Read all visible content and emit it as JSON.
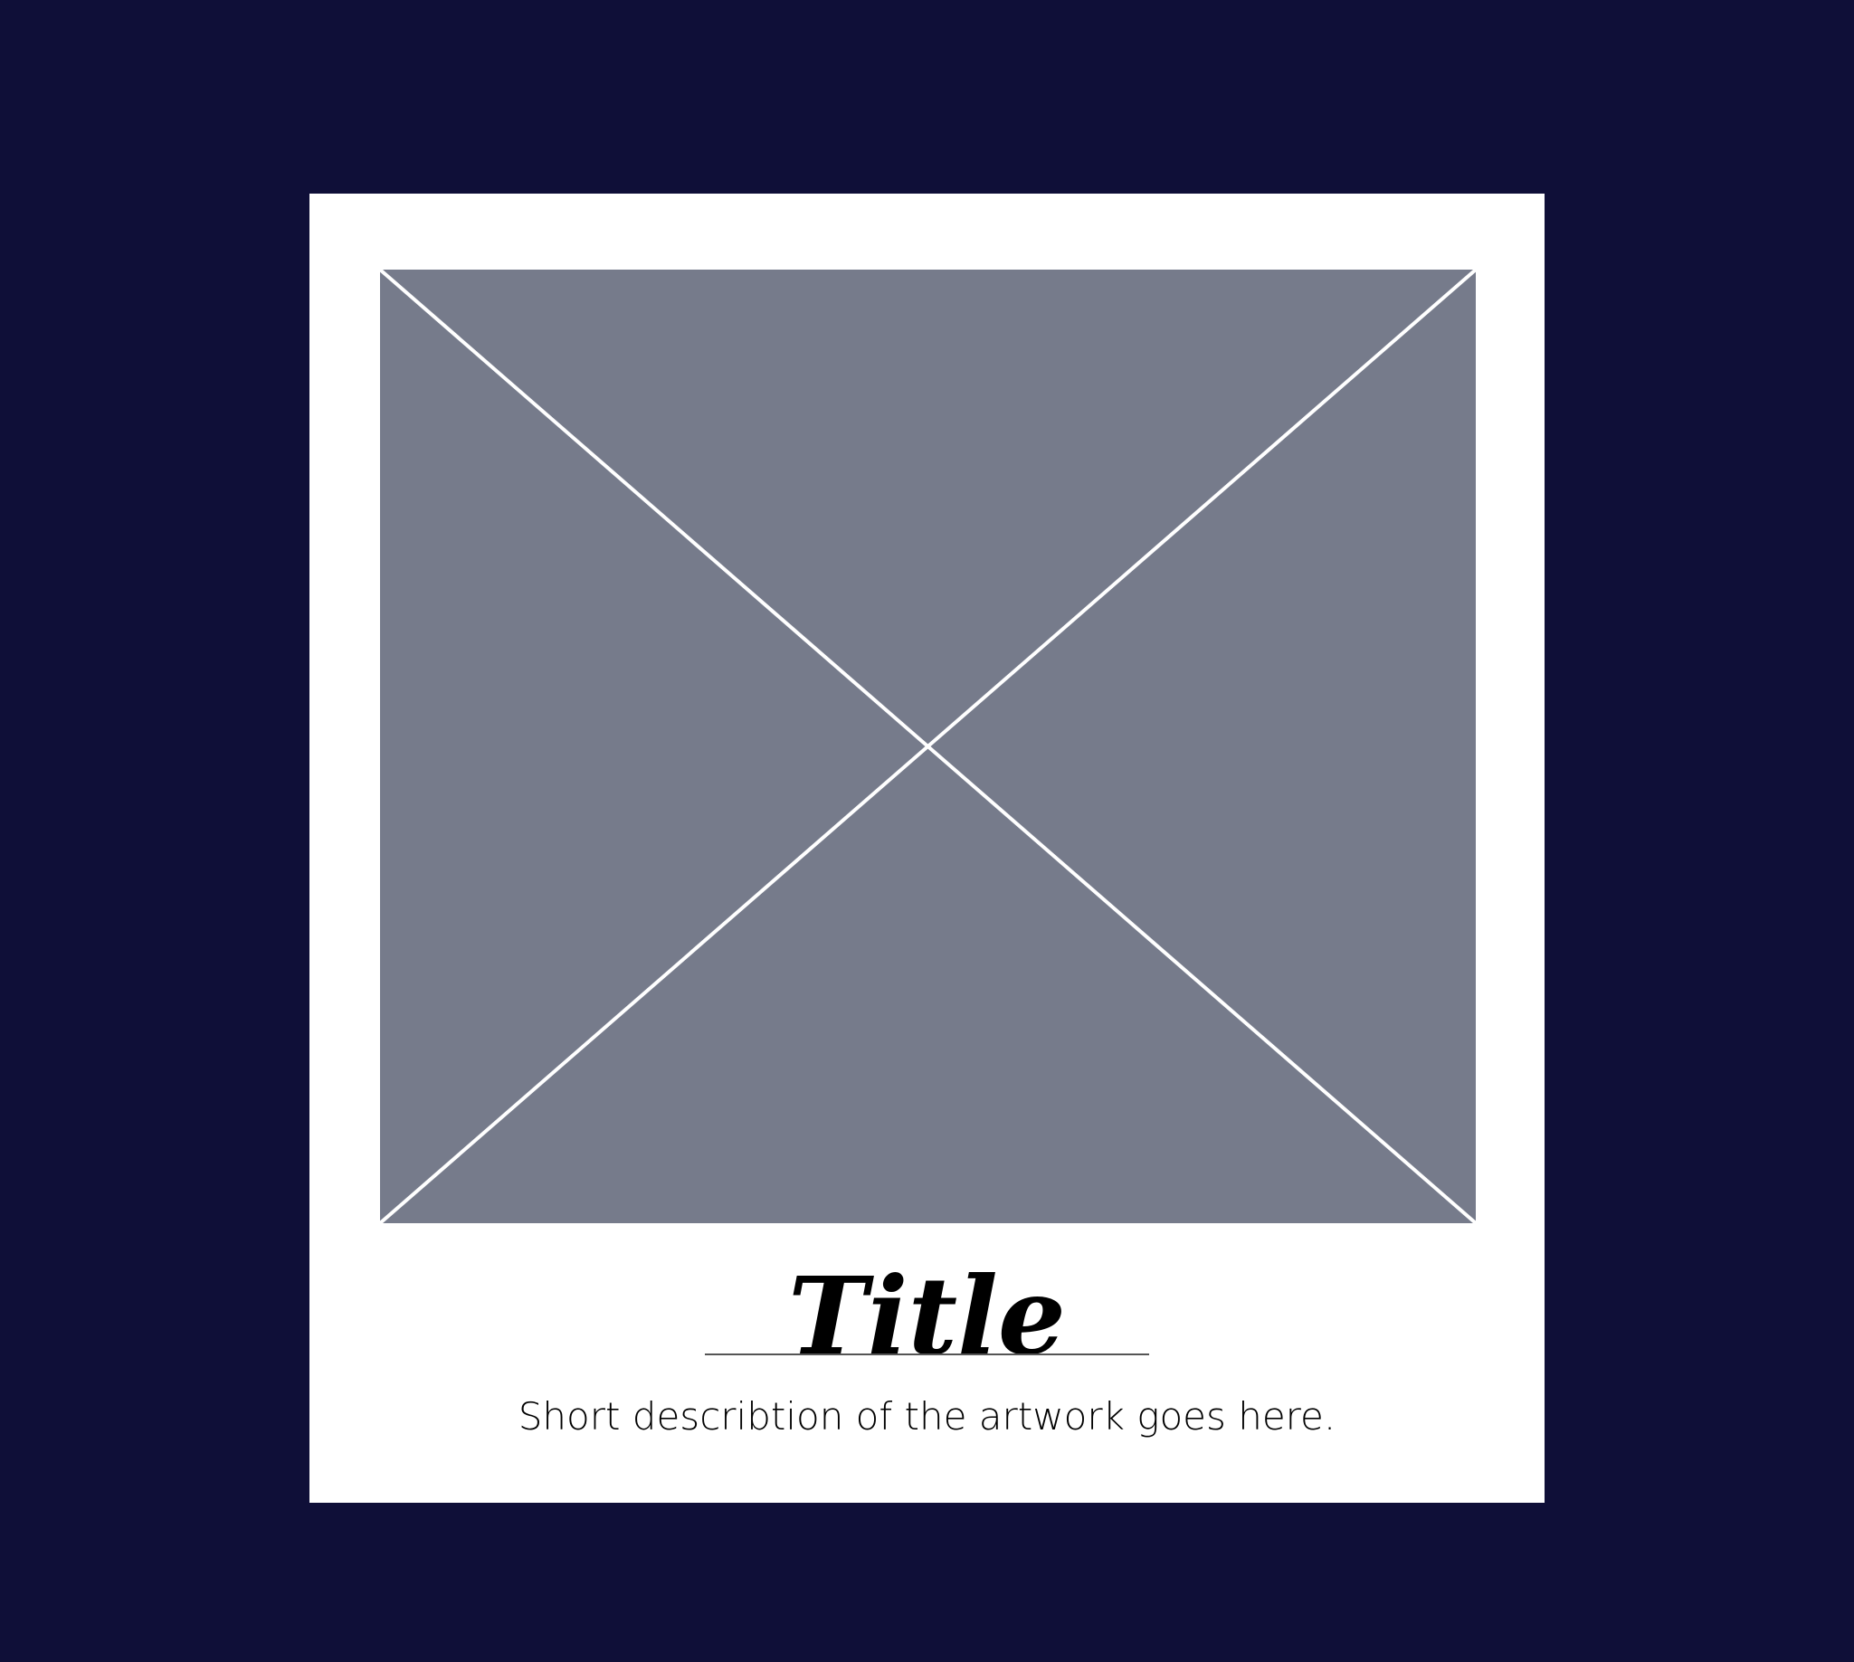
{
  "colors": {
    "background": "#0f0f38",
    "card": "#ffffff",
    "placeholder_fill": "#767b8b",
    "placeholder_lines": "#ffffff",
    "text": "#000000",
    "rule": "#555555"
  },
  "card": {
    "title": "Title",
    "description": "Short describtion of the artwork goes here.",
    "image_icon": "image-placeholder-icon"
  }
}
